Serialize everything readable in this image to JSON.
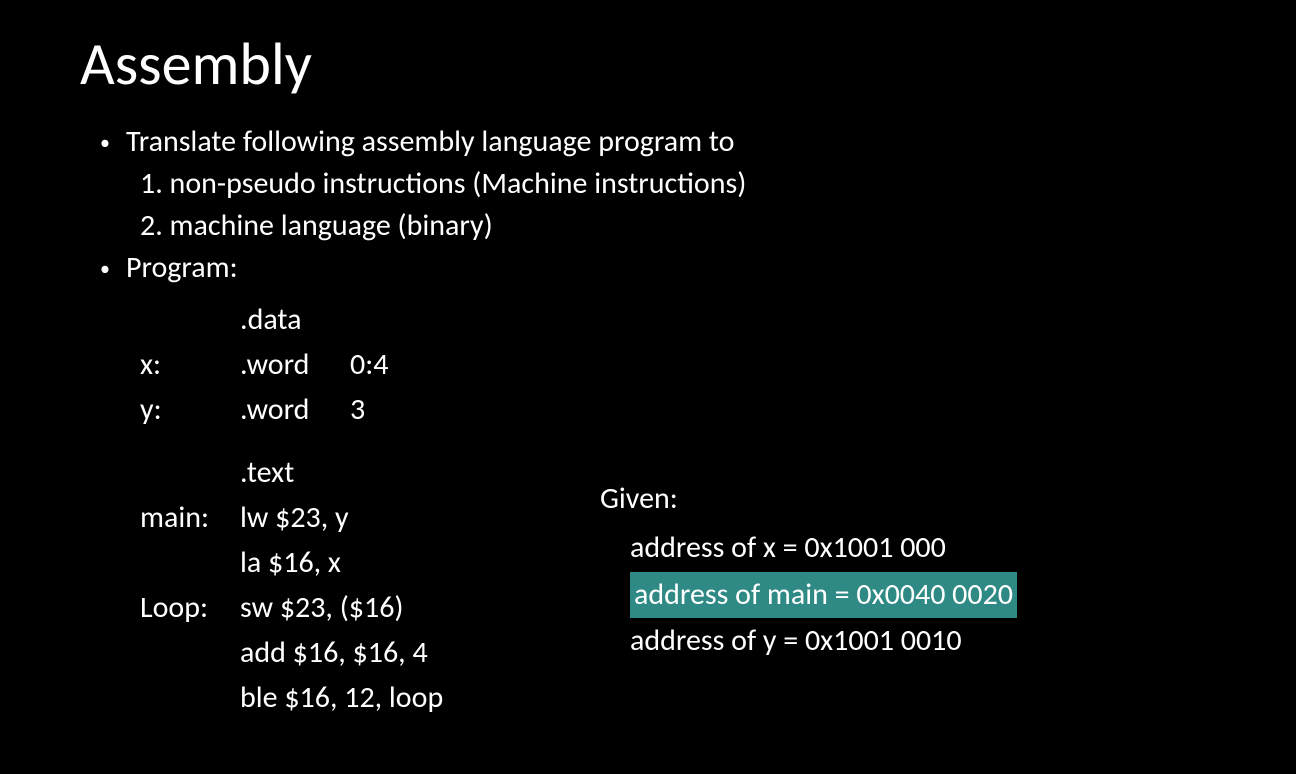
{
  "title": "Assembly",
  "bullets": {
    "b1_text": "Translate following assembly language program to",
    "sub1": "1. non-pseudo instructions (Machine instructions)",
    "sub2": "2. machine language (binary)",
    "b2_text": "Program:"
  },
  "code": {
    "data_dir": ".data",
    "x_label": "x:",
    "x_directive": ".word",
    "x_args": "0:4",
    "y_label": "y:",
    "y_directive": ".word",
    "y_args": "3",
    "text_dir": ".text",
    "main_label": "main:",
    "main_instr1": "lw $23, y",
    "main_instr2": "la $16, x",
    "loop_label": "Loop:",
    "loop_instr1": "sw $23, ($16)",
    "loop_instr2": "add $16, $16, 4",
    "loop_instr3": "ble  $16, 12, loop"
  },
  "given": {
    "title": "Given:",
    "addr_x": "address of x = 0x1001 000",
    "addr_main": "address of main = 0x0040 0020",
    "addr_y": "address of y = 0x1001 0010"
  }
}
